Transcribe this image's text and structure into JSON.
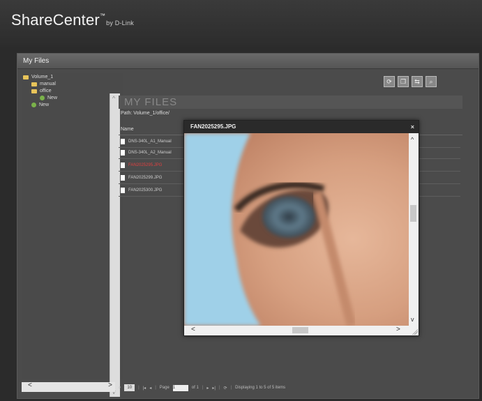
{
  "header": {
    "brand": "ShareCenter",
    "tm": "™",
    "by": "by D-Link"
  },
  "panel": {
    "title": "My Files"
  },
  "tree": {
    "items": [
      {
        "label": "Volume_1",
        "type": "folder"
      },
      {
        "label": "manual",
        "type": "folder"
      },
      {
        "label": "office",
        "type": "folder"
      },
      {
        "label": "New",
        "type": "new"
      },
      {
        "label": "New",
        "type": "new"
      }
    ]
  },
  "main": {
    "heading": "MY FILES",
    "path": "Path: Volume_1/office/",
    "column_name": "Name",
    "files": [
      {
        "name": "DNS-340L_A1_Manual",
        "selected": false
      },
      {
        "name": "DNS-340L_A2_Manual",
        "selected": false
      },
      {
        "name": "FAN2025295.JPG",
        "selected": true
      },
      {
        "name": "FAN2025299.JPG",
        "selected": false
      },
      {
        "name": "FAN2025300.JPG",
        "selected": false
      }
    ]
  },
  "pager": {
    "page_size": "10",
    "page_label": "Page",
    "page_value": "1",
    "of_label": "of 1",
    "display_text": "Displaying 1 to 5 of 5 items"
  },
  "modal": {
    "title": "FAN2025295.JPG",
    "close": "×"
  },
  "icons": {
    "scroll_up": "^",
    "scroll_down": "v",
    "scroll_left": "<",
    "scroll_right": ">"
  },
  "colors": {
    "selected_file": "#e04040",
    "new_badge": "#7ab24a",
    "folder": "#e8c45a"
  }
}
